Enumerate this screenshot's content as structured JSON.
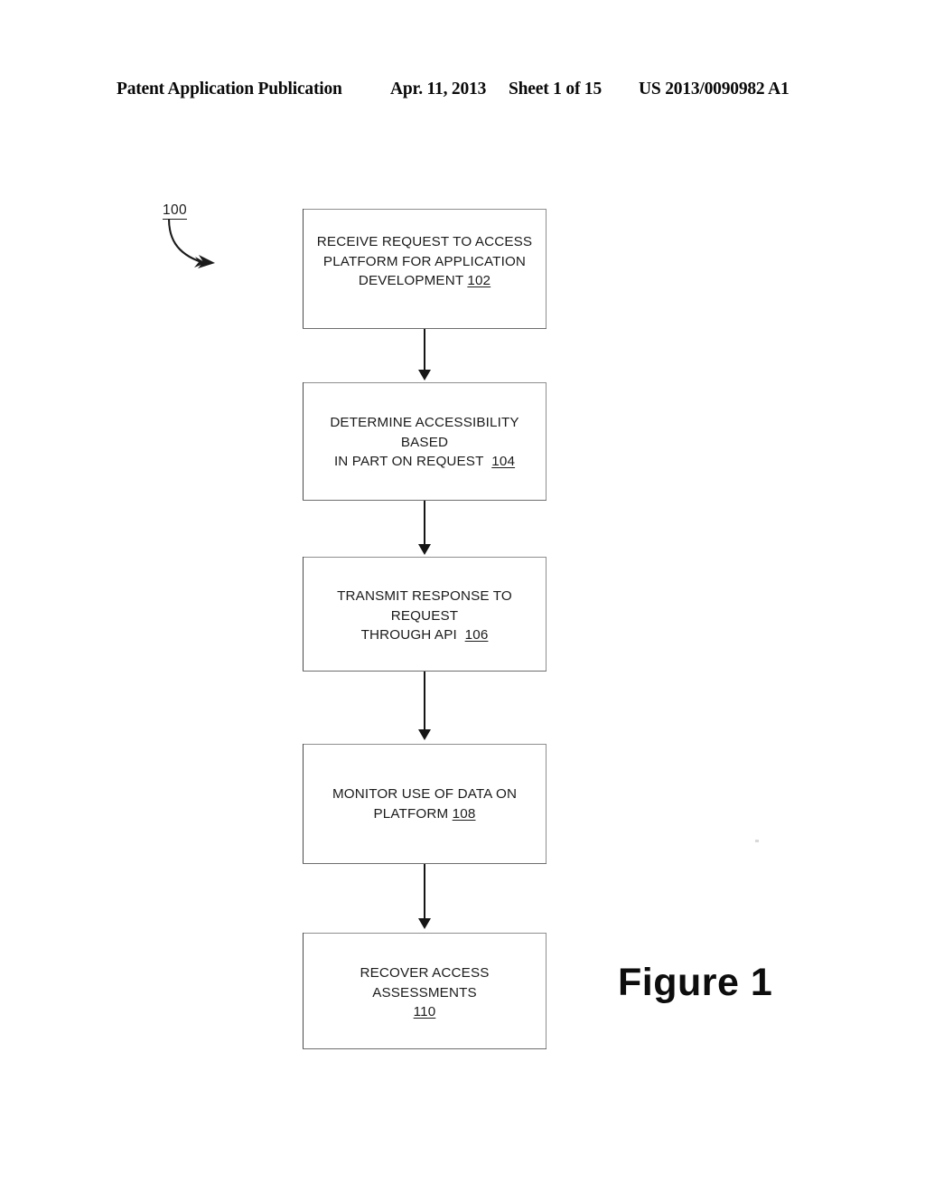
{
  "header": {
    "publication": "Patent Application Publication",
    "date": "Apr. 11, 2013",
    "sheet": "Sheet 1 of 15",
    "patent_number": "US 2013/0090982 A1"
  },
  "figure": {
    "caption": "Figure 1",
    "diagram_reference": "100"
  },
  "chart_data": {
    "type": "diagram",
    "subtype": "flowchart",
    "title": "Figure 1",
    "reference_numeral": "100",
    "orientation": "vertical top-to-bottom",
    "nodes": [
      {
        "id": "102",
        "shape": "rectangle",
        "lines": [
          "RECEIVE REQUEST TO ACCESS",
          "PLATFORM FOR APPLICATION",
          "DEVELOPMENT"
        ],
        "ref": "102",
        "full_text": "RECEIVE REQUEST TO ACCESS PLATFORM FOR APPLICATION DEVELOPMENT 102"
      },
      {
        "id": "104",
        "shape": "rectangle",
        "lines": [
          "DETERMINE ACCESSIBILITY BASED",
          "IN PART ON REQUEST"
        ],
        "ref": "104",
        "full_text": "DETERMINE ACCESSIBILITY BASED IN PART ON REQUEST 104"
      },
      {
        "id": "106",
        "shape": "rectangle",
        "lines": [
          "TRANSMIT RESPONSE TO REQUEST",
          "THROUGH API"
        ],
        "ref": "106",
        "full_text": "TRANSMIT RESPONSE TO REQUEST THROUGH API 106"
      },
      {
        "id": "108",
        "shape": "rectangle",
        "lines": [
          "MONITOR USE OF DATA ON",
          "PLATFORM"
        ],
        "ref": "108",
        "full_text": "MONITOR USE OF DATA ON PLATFORM 108"
      },
      {
        "id": "110",
        "shape": "rectangle",
        "lines": [
          "RECOVER ACCESS ASSESSMENTS"
        ],
        "ref": "110",
        "full_text": "RECOVER ACCESS ASSESSMENTS 110"
      }
    ],
    "edges": [
      {
        "from": "102",
        "to": "104",
        "style": "solid",
        "arrow": "filled-triangle"
      },
      {
        "from": "104",
        "to": "106",
        "style": "solid",
        "arrow": "filled-triangle"
      },
      {
        "from": "106",
        "to": "108",
        "style": "solid",
        "arrow": "filled-triangle"
      },
      {
        "from": "108",
        "to": "110",
        "style": "solid",
        "arrow": "filled-triangle"
      }
    ]
  }
}
